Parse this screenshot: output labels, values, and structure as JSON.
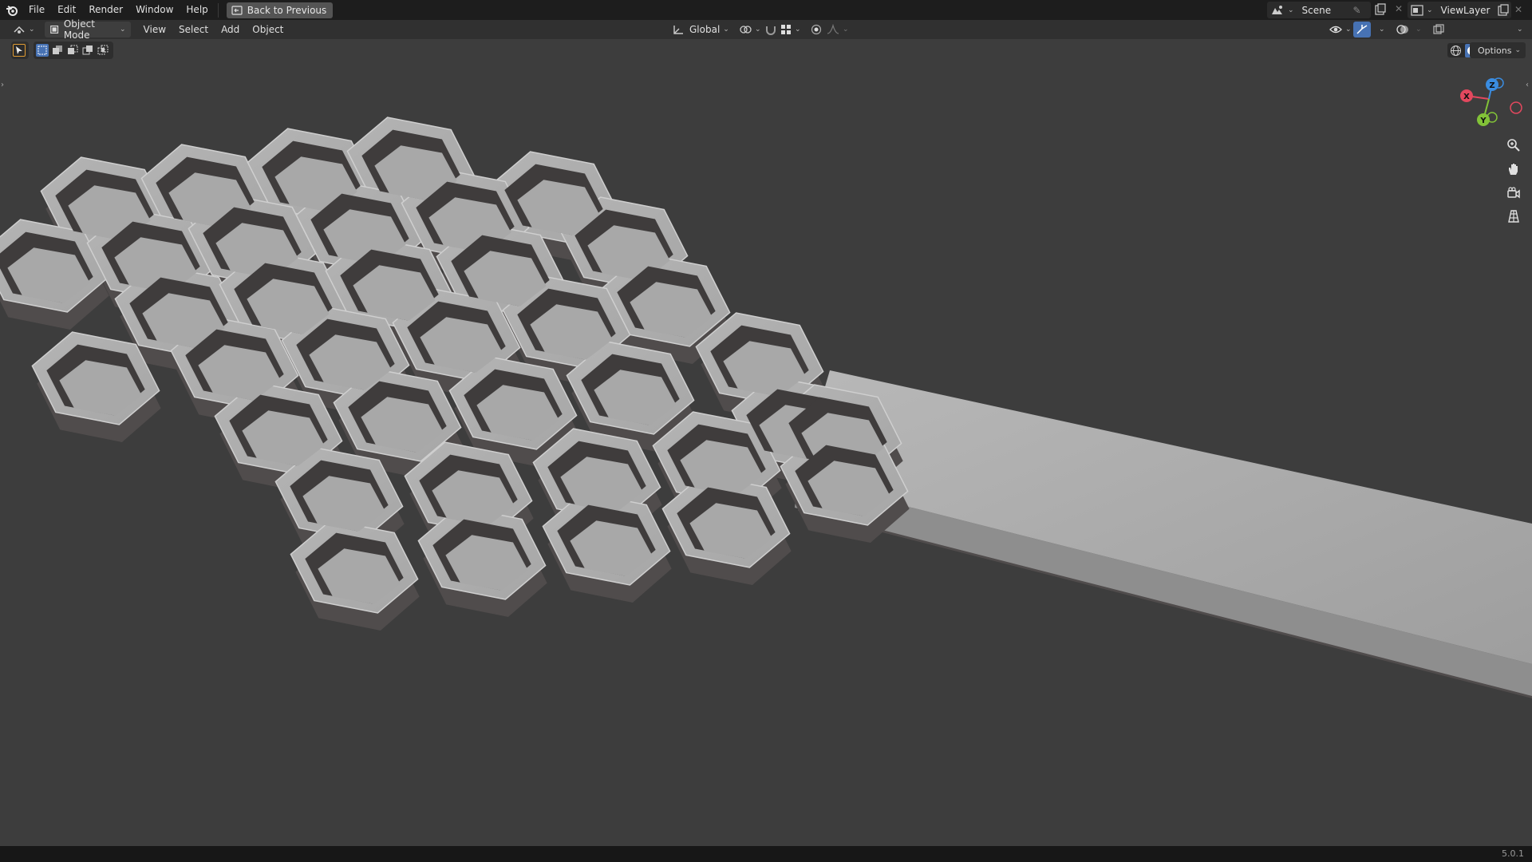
{
  "app": {
    "name": "Blender",
    "version": "5.0.1"
  },
  "topbar": {
    "menus": [
      "File",
      "Edit",
      "Render",
      "Window",
      "Help"
    ],
    "back_label": "Back to Previous",
    "scene_name": "Scene",
    "view_layer_name": "ViewLayer"
  },
  "header": {
    "mode_label": "Object Mode",
    "menus": [
      "View",
      "Select",
      "Add",
      "Object"
    ],
    "transform_orientation": "Global",
    "options_label": "Options"
  },
  "gizmo": {
    "x": "X",
    "y": "Y",
    "z": "Z"
  },
  "icons": {
    "logo": "blender-logo-icon",
    "back": "back-to-previous-icon",
    "zoom": "zoom-icon",
    "pan": "pan-hand-icon",
    "camera": "camera-view-icon",
    "ortho": "perspective-grid-icon"
  },
  "colors": {
    "viewport_bg": "#3d3d3d",
    "mesh_light": "#c4c4c4",
    "mesh_mid": "#a8a8a8",
    "mesh_dark": "#504c4c",
    "axis_x": "#e3485e",
    "axis_y": "#82c238",
    "axis_z": "#3a8ce0"
  }
}
